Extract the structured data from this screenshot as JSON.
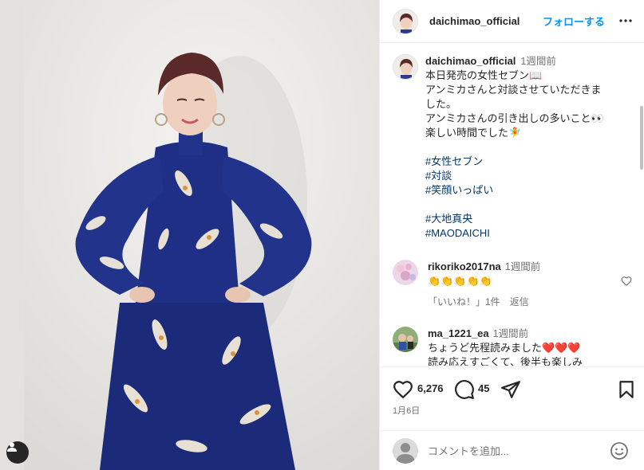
{
  "post": {
    "username": "daichimao_official",
    "follow_label": "フォローする",
    "caption": {
      "username": "daichimao_official",
      "ago": "1週間前",
      "lines": [
        "本日発売の女性セブン📖",
        "アンミカさんと対談させていただきま",
        "した。",
        "アンミカさんの引き出しの多いこと👀",
        "楽しい時間でした🧚"
      ],
      "hashtags_a": [
        "#女性セブン",
        "#対談",
        "#笑顔いっぱい"
      ],
      "hashtags_b": [
        "#大地真央",
        "#MAODAICHI"
      ]
    },
    "comments": [
      {
        "username": "rikoriko2017na",
        "ago": "1週間前",
        "text": "👏👏👏👏👏",
        "likes": "「いいね！」1件",
        "reply": "返信"
      },
      {
        "username": "ma_1221_ea",
        "ago": "1週間前",
        "text": "ちょうど先程読みました❤️❤️❤️",
        "text2": "読み応えすごくて、後半も楽しみ"
      }
    ],
    "likes": "6,276",
    "comments_count": "45",
    "date": "1月6日",
    "comment_placeholder": "コメントを追加...",
    "colors": {
      "link": "#00376b",
      "follow": "#0095f6",
      "muted": "#737373",
      "dress": "#1c2a7a"
    }
  }
}
